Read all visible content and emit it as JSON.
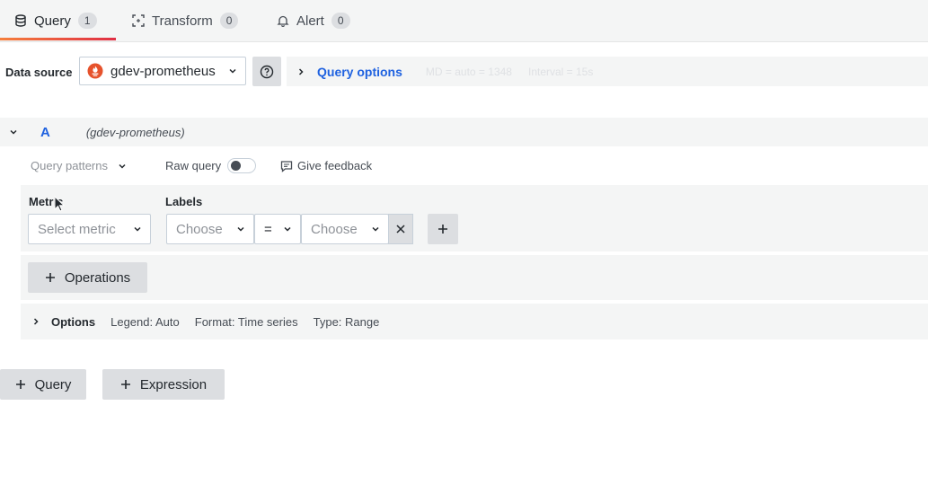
{
  "tabs": [
    {
      "label": "Query",
      "count": "1",
      "icon": "database-icon"
    },
    {
      "label": "Transform",
      "count": "0",
      "icon": "transform-icon"
    },
    {
      "label": "Alert",
      "count": "0",
      "icon": "bell-icon"
    }
  ],
  "datasource": {
    "label": "Data source",
    "selected": "gdev-prometheus",
    "icon": "prometheus-icon",
    "query_options_label": "Query options",
    "query_options_hint_md": "MD = auto = 1348",
    "query_options_hint_interval": "Interval = 15s"
  },
  "query_row": {
    "ref_id": "A",
    "datasource_name": "(gdev-prometheus)"
  },
  "toolbar": {
    "query_patterns": "Query patterns",
    "raw_query": "Raw query",
    "raw_query_on": false,
    "give_feedback": "Give feedback"
  },
  "builder": {
    "metric_label": "Metric",
    "metric_placeholder": "Select metric",
    "labels_label": "Labels",
    "label_key_placeholder": "Choose",
    "label_operator": "=",
    "label_value_placeholder": "Choose",
    "operations_button": "Operations"
  },
  "options": {
    "title": "Options",
    "legend": "Legend: Auto",
    "format": "Format: Time series",
    "type": "Type: Range"
  },
  "footer": {
    "add_query": "Query",
    "add_expression": "Expression"
  },
  "colors": {
    "accent_blue": "#1f62e0",
    "tab_underline_start": "#f57f3c",
    "tab_underline_end": "#e02f44",
    "prometheus_orange": "#e6522c"
  }
}
